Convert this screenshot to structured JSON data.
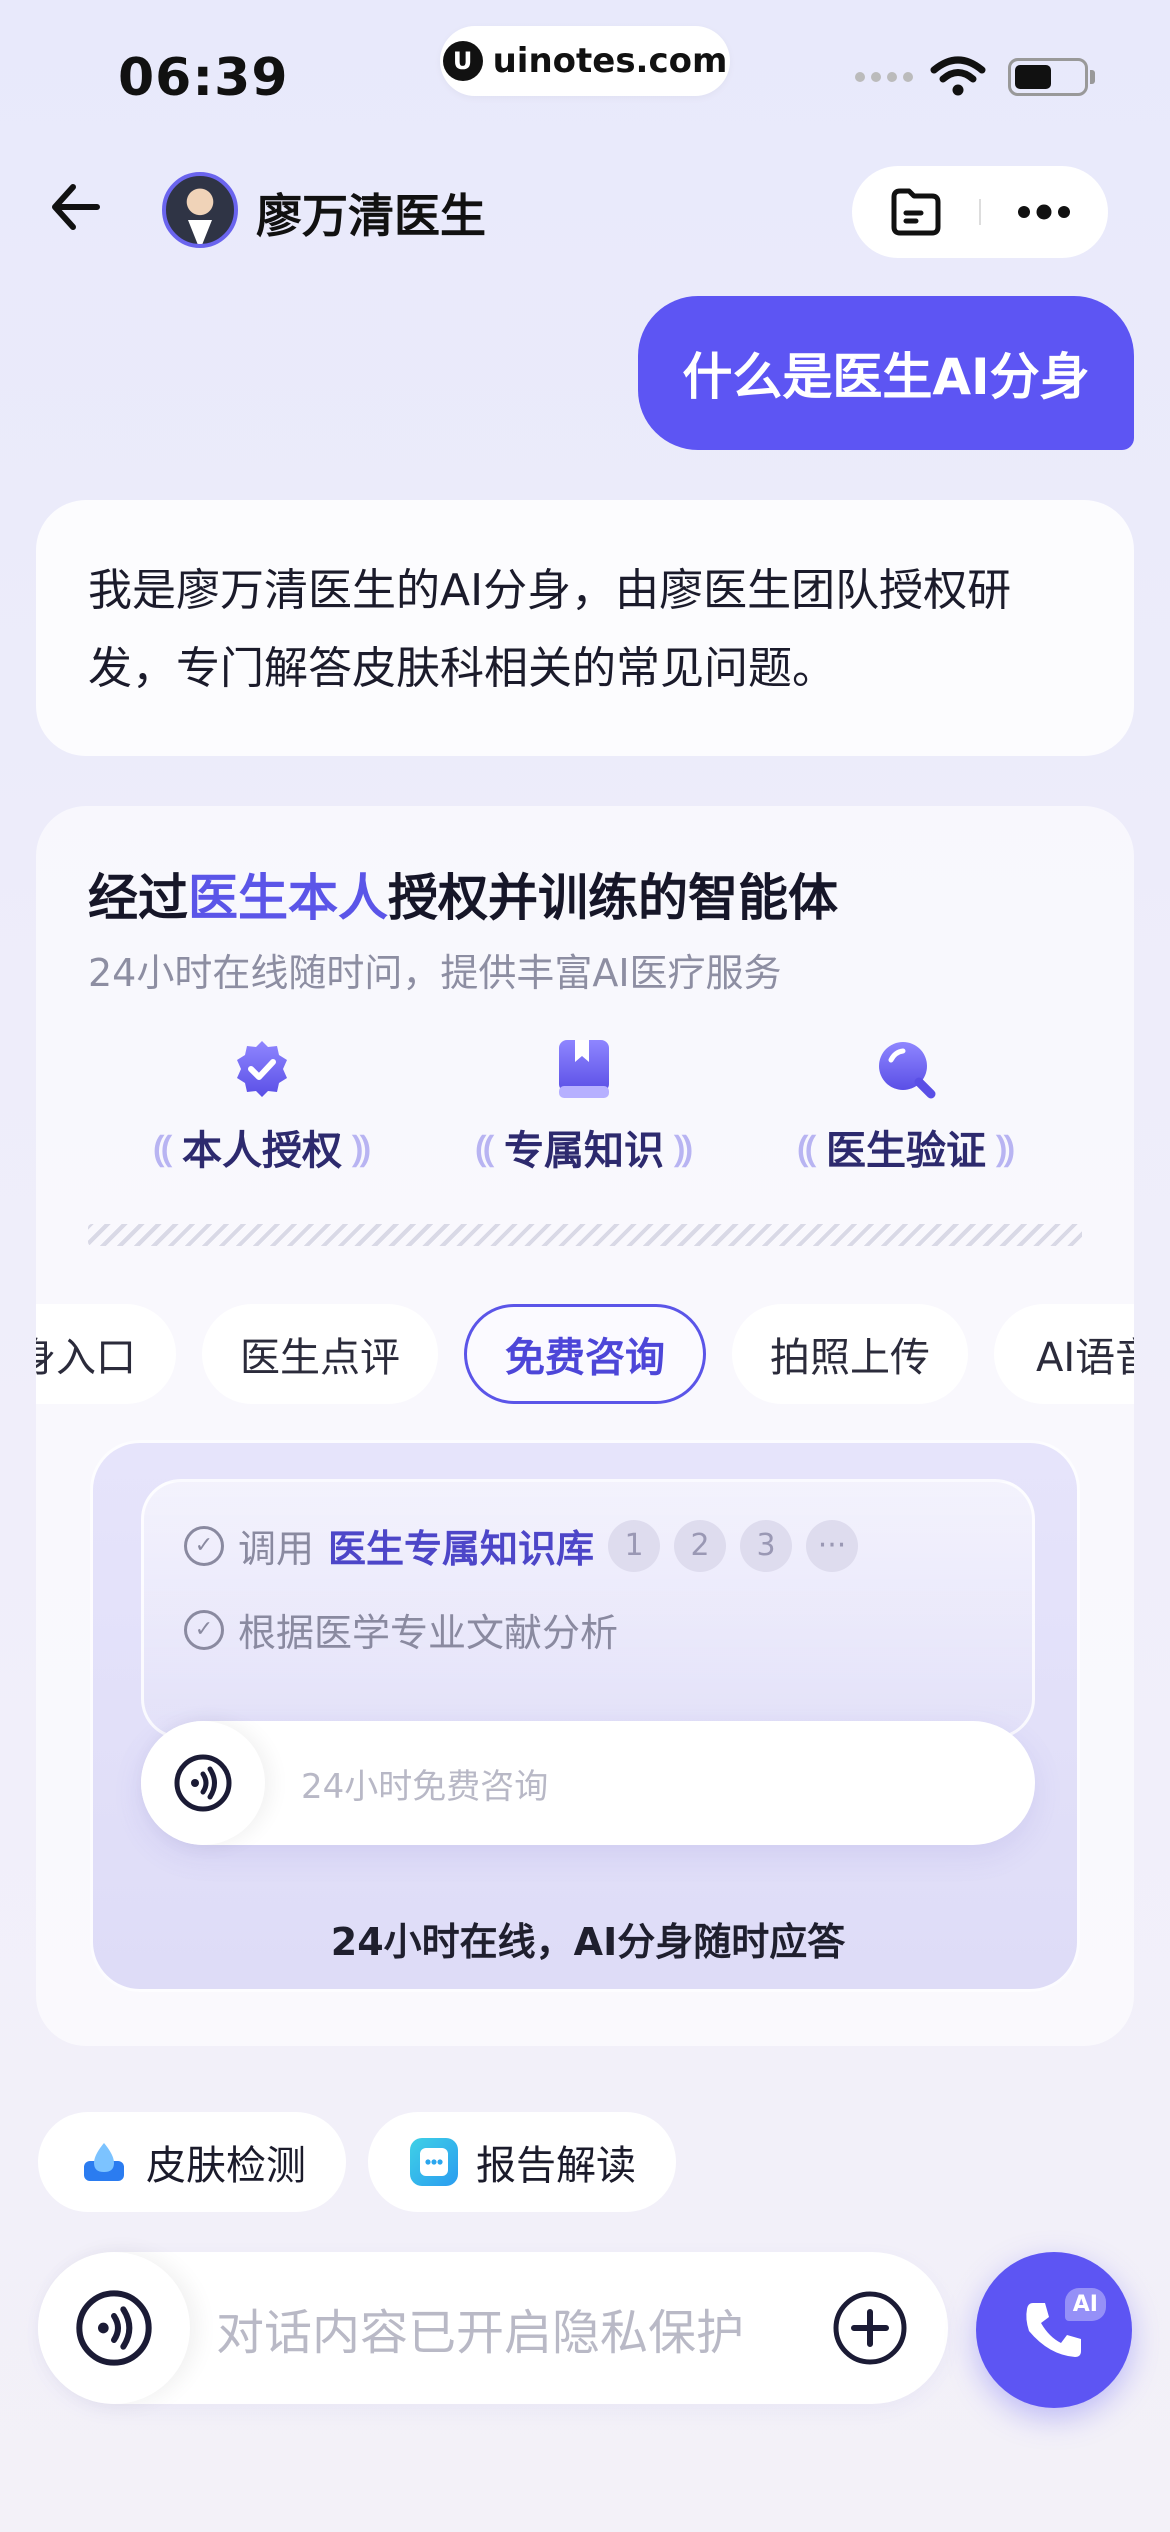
{
  "status_bar": {
    "time": "06:39",
    "watermark": "uinotes.com",
    "watermark_logo": "U"
  },
  "header": {
    "doctor_name": "廖万清医生",
    "icons": [
      "back-arrow-icon",
      "folder-chat-icon",
      "more-icon"
    ]
  },
  "chat": {
    "user_message": "什么是医生AI分身",
    "ai_message": "我是廖万清医生的AI分身，由廖医生团队授权研发，专门解答皮肤科相关的常见问题。"
  },
  "info_card": {
    "title_prefix": "经过",
    "title_highlight": "医生本人",
    "title_suffix": "授权并训练的智能体",
    "subtitle": "24小时在线随时问，提供丰富AI医疗服务",
    "features": [
      {
        "label": "本人授权",
        "icon": "shield-check-icon"
      },
      {
        "label": "专属知识",
        "icon": "book-icon"
      },
      {
        "label": "医生验证",
        "icon": "magnifier-icon"
      }
    ],
    "laurel_glyph_left": "⸨",
    "laurel_glyph_right": "⸩",
    "tabs": [
      {
        "label": "身入口"
      },
      {
        "label": "医生点评"
      },
      {
        "label": "免费咨询",
        "active": true
      },
      {
        "label": "拍照上传"
      },
      {
        "label": "AI语音"
      }
    ],
    "demo": {
      "step1_prefix": "调用",
      "step1_kb": "医生专属知识库",
      "step1_chips": [
        "1",
        "2",
        "3",
        "···"
      ],
      "step2": "根据医学专业文献分析",
      "input_placeholder": "24小时免费咨询",
      "caption": "24小时在线，AI分身随时应答"
    }
  },
  "quick_actions": [
    {
      "label": "皮肤检测",
      "icon": "skin-drop-icon"
    },
    {
      "label": "报告解读",
      "icon": "report-chat-icon"
    }
  ],
  "composer": {
    "placeholder": "对话内容已开启隐私保护",
    "call_badge": "AI"
  },
  "colors": {
    "accent": "#5d55f3",
    "highlight_text": "#5b55e8",
    "background": "#eceafa"
  }
}
